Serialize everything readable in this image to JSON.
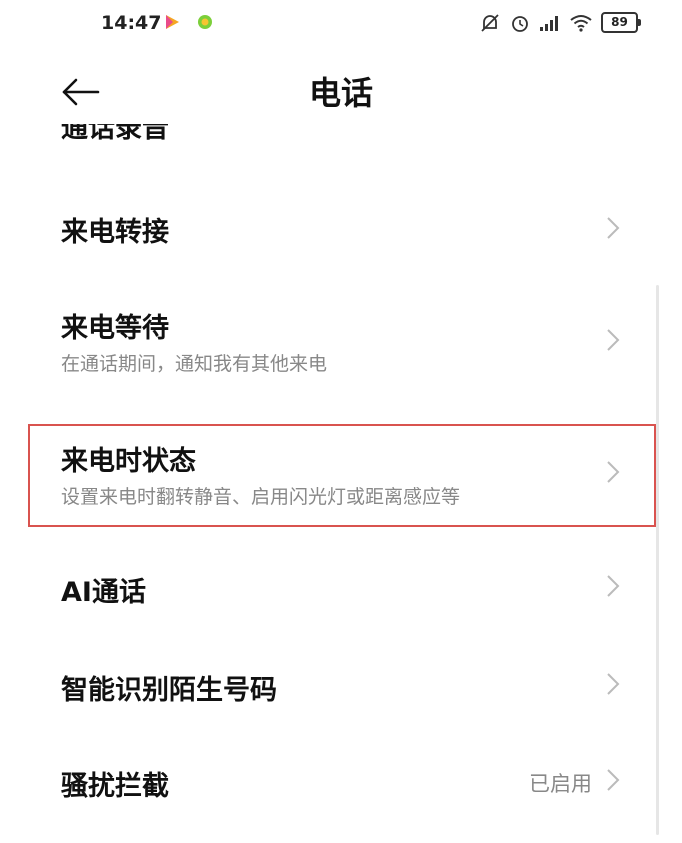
{
  "status_bar": {
    "time": "14:47",
    "battery": "89",
    "icons": [
      "play-store-icon",
      "browser-icon",
      "muted-icon",
      "alarm-icon",
      "signal-icon",
      "wifi-icon",
      "battery-icon"
    ]
  },
  "header": {
    "title": "电话",
    "back_icon": "arrow-left-icon"
  },
  "list": {
    "partial_top_title": "通话录音",
    "items": [
      {
        "title": "来电转接",
        "subtitle": "",
        "value": ""
      },
      {
        "title": "来电等待",
        "subtitle": "在通话期间，通知我有其他来电",
        "value": ""
      },
      {
        "title": "来电时状态",
        "subtitle": "设置来电时翻转静音、启用闪光灯或距离感应等",
        "value": ""
      },
      {
        "title": "AI通话",
        "subtitle": "",
        "value": ""
      },
      {
        "title": "智能识别陌生号码",
        "subtitle": "",
        "value": ""
      },
      {
        "title": "骚扰拦截",
        "subtitle": "",
        "value": "已启用"
      }
    ]
  },
  "colors": {
    "highlight_border": "#d9534f",
    "subtitle": "#888888",
    "chevron": "#bbbbbb"
  }
}
